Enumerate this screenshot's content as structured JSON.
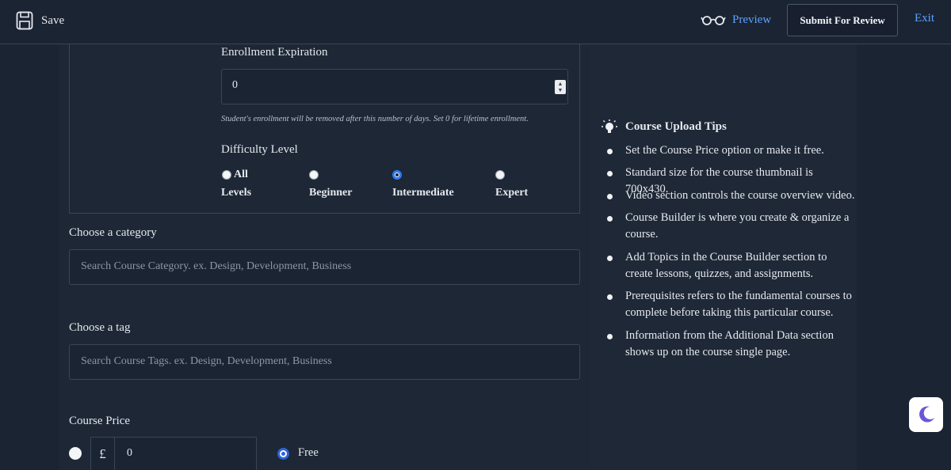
{
  "toolbar": {
    "save_label": "Save",
    "preview_label": "Preview",
    "submit_label": "Submit For Review",
    "exit_label": "Exit"
  },
  "enrollment": {
    "label": "Enrollment Expiration",
    "value": "0",
    "help": "Student's enrollment will be removed after this number of days. Set 0 for lifetime enrollment."
  },
  "difficulty": {
    "label": "Difficulty Level",
    "options": [
      {
        "label_line1": "All",
        "label_line2": "Levels",
        "selected": false
      },
      {
        "label_line1": "",
        "label_line2": "Beginner",
        "selected": false
      },
      {
        "label_line1": "",
        "label_line2": "Intermediate",
        "selected": true
      },
      {
        "label_line1": "",
        "label_line2": "Expert",
        "selected": false
      }
    ]
  },
  "category": {
    "label": "Choose a category",
    "placeholder": "Search Course Category. ex. Design, Development, Business"
  },
  "tag": {
    "label": "Choose a tag",
    "placeholder": "Search Course Tags. ex. Design, Development, Business"
  },
  "price": {
    "label": "Course Price",
    "currency": "£",
    "value": "0",
    "free_label": "Free",
    "free_selected": true
  },
  "tips": {
    "title": "Course Upload Tips",
    "items": [
      "Set the Course Price option or make it free.",
      "Standard size for the course thumbnail is 700x430.",
      "Video section controls the course overview video.",
      "Course Builder is where you create & organize a course.",
      "Add Topics in the Course Builder section to create lessons, quizzes, and assignments.",
      "Prerequisites refers to the fundamental courses to complete before taking this particular course.",
      "Information from the Additional Data section shows up on the course single page."
    ]
  },
  "colors": {
    "background": "#1b2433",
    "accent_link": "#5aa2ff",
    "radio_selected": "#2f7bf2"
  },
  "icons": {
    "save": "floppy-disk-icon",
    "preview": "glasses-icon",
    "tips": "lightbulb-icon",
    "theme": "moon-icon"
  }
}
